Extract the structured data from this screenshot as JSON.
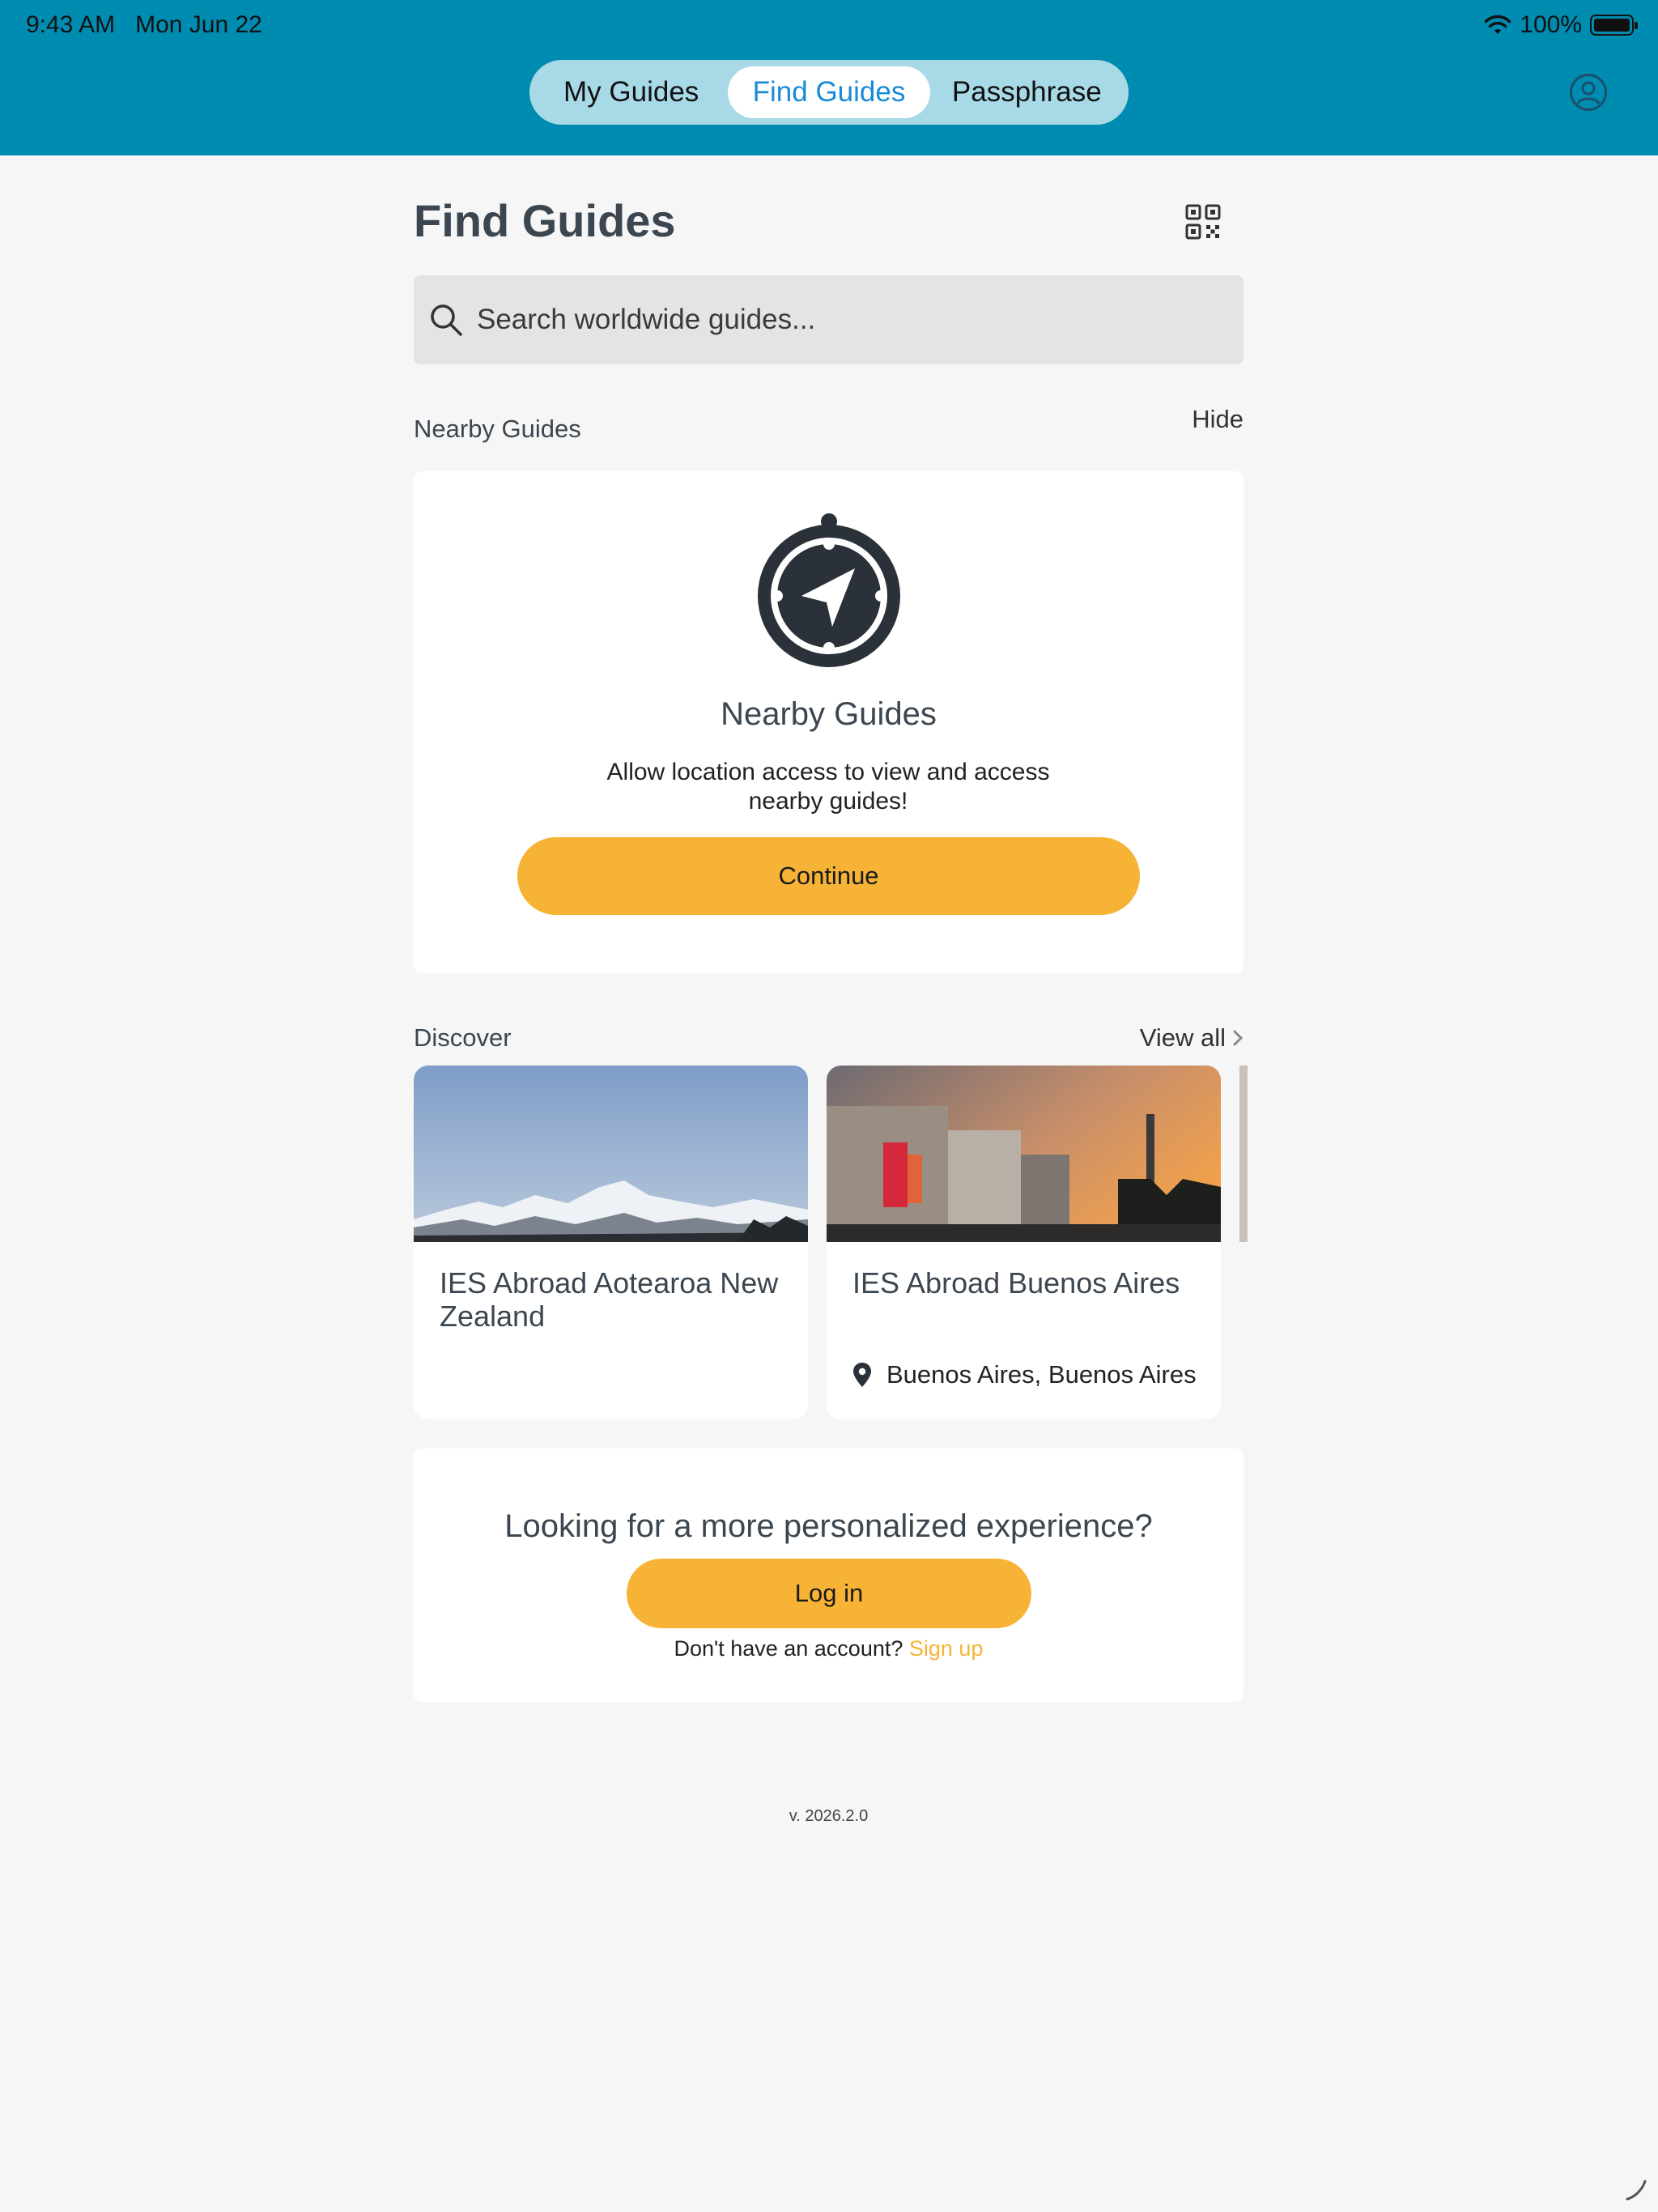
{
  "status_bar": {
    "time": "9:43 AM",
    "date": "Mon Jun 22",
    "battery": "100%"
  },
  "nav": {
    "tabs": [
      {
        "label": "My Guides"
      },
      {
        "label": "Find Guides",
        "selected": true
      },
      {
        "label": "Passphrase"
      }
    ],
    "profile_icon": "user-circle-icon"
  },
  "page": {
    "title": "Find Guides",
    "qr_icon": "qr-code-icon"
  },
  "search": {
    "placeholder": "Search worldwide guides..."
  },
  "nearby": {
    "section_label": "Nearby Guides",
    "hide_label": "Hide",
    "card_title": "Nearby Guides",
    "description": "Allow location access to view and access nearby guides!",
    "continue_label": "Continue",
    "icon": "compass-icon"
  },
  "discover": {
    "section_label": "Discover",
    "view_all_label": "View all",
    "guides": [
      {
        "title": "IES Abroad Aotearoa New Zealand",
        "location": ""
      },
      {
        "title": "IES Abroad Buenos Aires",
        "location": "Buenos Aires, Buenos Aires"
      }
    ]
  },
  "login": {
    "question": "Looking for a more personalized experience?",
    "login_label": "Log in",
    "no_account_text": "Don't have an account?",
    "signup_label": "Sign up"
  },
  "footer": {
    "version": "v. 2026.2.0"
  },
  "colors": {
    "header": "#008bb1",
    "accent_yellow": "#f6b336",
    "active_tab_text": "#1a8ad6",
    "background": "#f6f6f6"
  }
}
